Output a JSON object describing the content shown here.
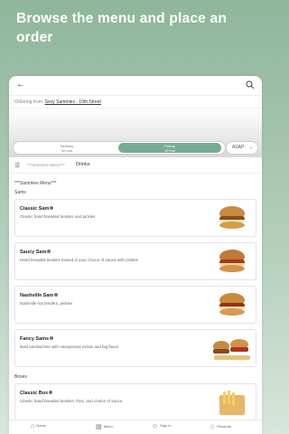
{
  "headline": "Browse the menu and place an order",
  "topbar": {
    "back_icon": "arrow-left-icon",
    "search_icon": "search-icon"
  },
  "ordering": {
    "prefix": "Ordering from:",
    "store": "Sexy Sammies - 10th Street"
  },
  "toggle": {
    "delivery_label": "Delivery",
    "delivery_time": "40 min",
    "pickup_label": "Pickup",
    "pickup_time": "10 min",
    "time_select": "ASAP",
    "accent_color": "#78ac92"
  },
  "tabs": {
    "tab1": "***Sammies Menu***",
    "tab2": "Drinks"
  },
  "menu": {
    "title": "***Sammies Menu***",
    "section1": "Sams",
    "items": [
      {
        "name": "Classic Sam",
        "desc": "Classic hand breaded tenders and pickles"
      },
      {
        "name": "Saucy Sam",
        "desc": "Hand breaded tenders tossed in your choice of sauce with pickles"
      },
      {
        "name": "Nashville Sam",
        "desc": "Nashville hot tenders, pickles"
      },
      {
        "name": "Fancy Sams",
        "desc": "Bold sandwiches with unexpected extras and big flavor"
      }
    ],
    "section2": "Boxes",
    "box_items": [
      {
        "name": "Classic Box",
        "desc": "Classic hand breaded tenders, fries, and choice of sauce"
      }
    ]
  },
  "bottomnav": {
    "home": "Home",
    "menu": "Menu",
    "signin": "Sign In",
    "rewards": "Rewards"
  }
}
